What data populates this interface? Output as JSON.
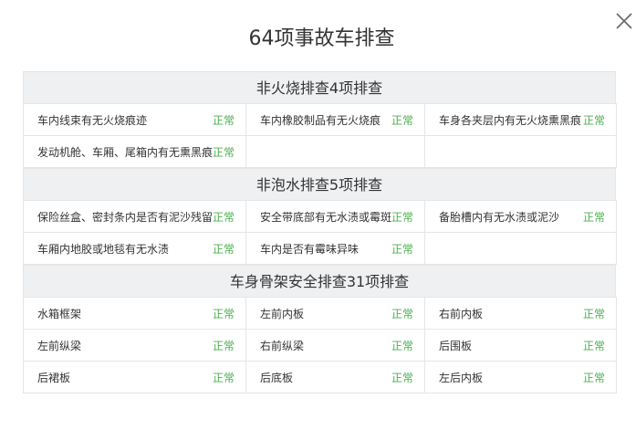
{
  "dialog": {
    "title": "64项事故车排查"
  },
  "colors": {
    "status_ok": "#4caf50",
    "header_bg": "#eef0f2",
    "border": "#e6e6e6"
  },
  "sections": [
    {
      "title": "非火烧排查4项排查",
      "items": [
        {
          "name": "车内线束有无火烧痕迹",
          "status": "正常"
        },
        {
          "name": "车内橡胶制品有无火烧痕",
          "status": "正常"
        },
        {
          "name": "车身各夹层内有无火烧熏黑痕",
          "status": "正常"
        },
        {
          "name": "发动机舱、车厢、尾箱内有无熏黑痕",
          "status": "正常"
        }
      ]
    },
    {
      "title": "非泡水排查5项排查",
      "items": [
        {
          "name": "保险丝盒、密封条内是否有泥沙残留",
          "status": "正常"
        },
        {
          "name": "安全带底部有无水渍或霉斑",
          "status": "正常"
        },
        {
          "name": "备胎槽内有无水渍或泥沙",
          "status": "正常"
        },
        {
          "name": "车厢内地胶或地毯有无水渍",
          "status": "正常"
        },
        {
          "name": "车内是否有霉味异味",
          "status": "正常"
        }
      ]
    },
    {
      "title": "车身骨架安全排查31项排查",
      "items": [
        {
          "name": "水箱框架",
          "status": "正常"
        },
        {
          "name": "左前内板",
          "status": "正常"
        },
        {
          "name": "右前内板",
          "status": "正常"
        },
        {
          "name": "左前纵梁",
          "status": "正常"
        },
        {
          "name": "右前纵梁",
          "status": "正常"
        },
        {
          "name": "后围板",
          "status": "正常"
        },
        {
          "name": "后裙板",
          "status": "正常"
        },
        {
          "name": "后底板",
          "status": "正常"
        },
        {
          "name": "左后内板",
          "status": "正常"
        }
      ]
    }
  ]
}
